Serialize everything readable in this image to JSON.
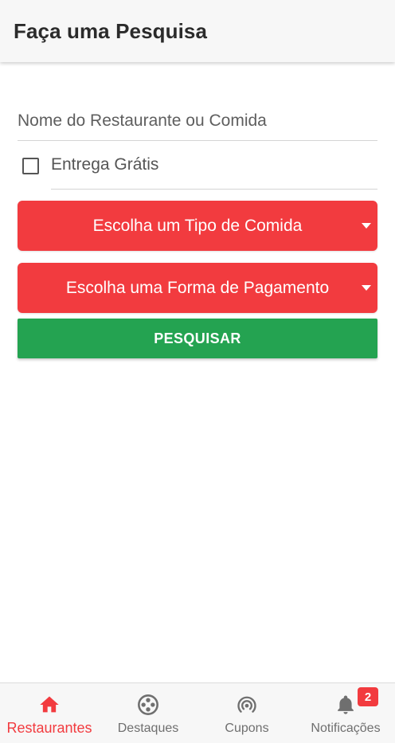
{
  "header": {
    "title": "Faça uma Pesquisa"
  },
  "search": {
    "placeholder": "Nome do Restaurante ou Comida",
    "value": ""
  },
  "free_delivery": {
    "label": "Entrega Grátis",
    "checked": false
  },
  "food_type_select": {
    "label": "Escolha um Tipo de Comida",
    "icon": "caret-down-icon"
  },
  "payment_select": {
    "label": "Escolha uma Forma de Pagamento",
    "icon": "caret-down-icon"
  },
  "search_button": {
    "label": "PESQUISAR"
  },
  "bottom_nav": {
    "items": [
      {
        "label": "Restaurantes",
        "icon": "home-icon",
        "active": true
      },
      {
        "label": "Destaques",
        "icon": "highlights-icon",
        "active": false
      },
      {
        "label": "Cupons",
        "icon": "broadcast-icon",
        "active": false
      },
      {
        "label": "Notificações",
        "icon": "bell-icon",
        "active": false,
        "badge": "2"
      }
    ]
  },
  "colors": {
    "accent": "#f23b3f",
    "success": "#24a351",
    "header_bg": "#f7f7f7"
  }
}
